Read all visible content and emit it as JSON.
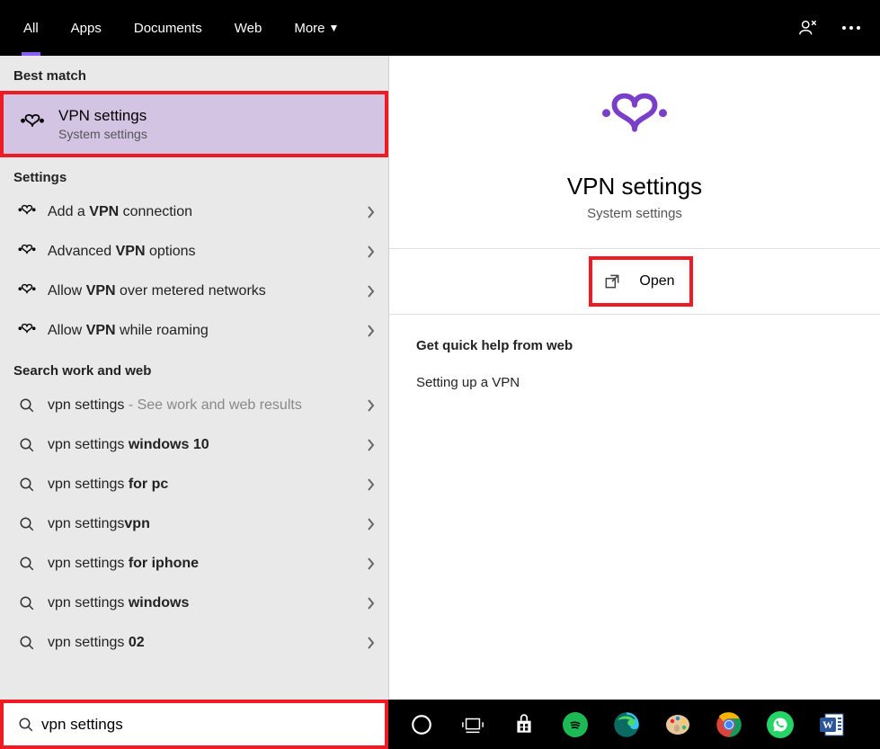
{
  "tabs": {
    "all": "All",
    "apps": "Apps",
    "documents": "Documents",
    "web": "Web",
    "more": "More"
  },
  "sections": {
    "best_match": "Best match",
    "settings": "Settings",
    "search_web": "Search work and web"
  },
  "best_match": {
    "title": "VPN settings",
    "subtitle": "System settings"
  },
  "settings_items": [
    {
      "pre": "Add a ",
      "bold": "VPN",
      "post": " connection"
    },
    {
      "pre": "Advanced ",
      "bold": "VPN",
      "post": " options"
    },
    {
      "pre": "Allow ",
      "bold": "VPN",
      "post": " over metered networks"
    },
    {
      "pre": "Allow ",
      "bold": "VPN",
      "post": " while roaming"
    }
  ],
  "web_items": [
    {
      "main": "vpn settings",
      "bold": "",
      "suffix": " - See work and web results"
    },
    {
      "main": "vpn settings ",
      "bold": "windows 10",
      "suffix": ""
    },
    {
      "main": "vpn settings ",
      "bold": "for pc",
      "suffix": ""
    },
    {
      "main": "vpn settings",
      "bold": "vpn",
      "suffix": ""
    },
    {
      "main": "vpn settings ",
      "bold": "for iphone",
      "suffix": ""
    },
    {
      "main": "vpn settings ",
      "bold": "windows",
      "suffix": ""
    },
    {
      "main": "vpn settings ",
      "bold": "02",
      "suffix": ""
    }
  ],
  "right": {
    "title": "VPN settings",
    "subtitle": "System settings",
    "open": "Open",
    "help_header": "Get quick help from web",
    "help_item": "Setting up a VPN"
  },
  "search": {
    "value": "vpn settings"
  },
  "colors": {
    "accent": "#8a5cf6",
    "highlight": "#ee1b24",
    "selected_bg": "#d3c4e3"
  }
}
